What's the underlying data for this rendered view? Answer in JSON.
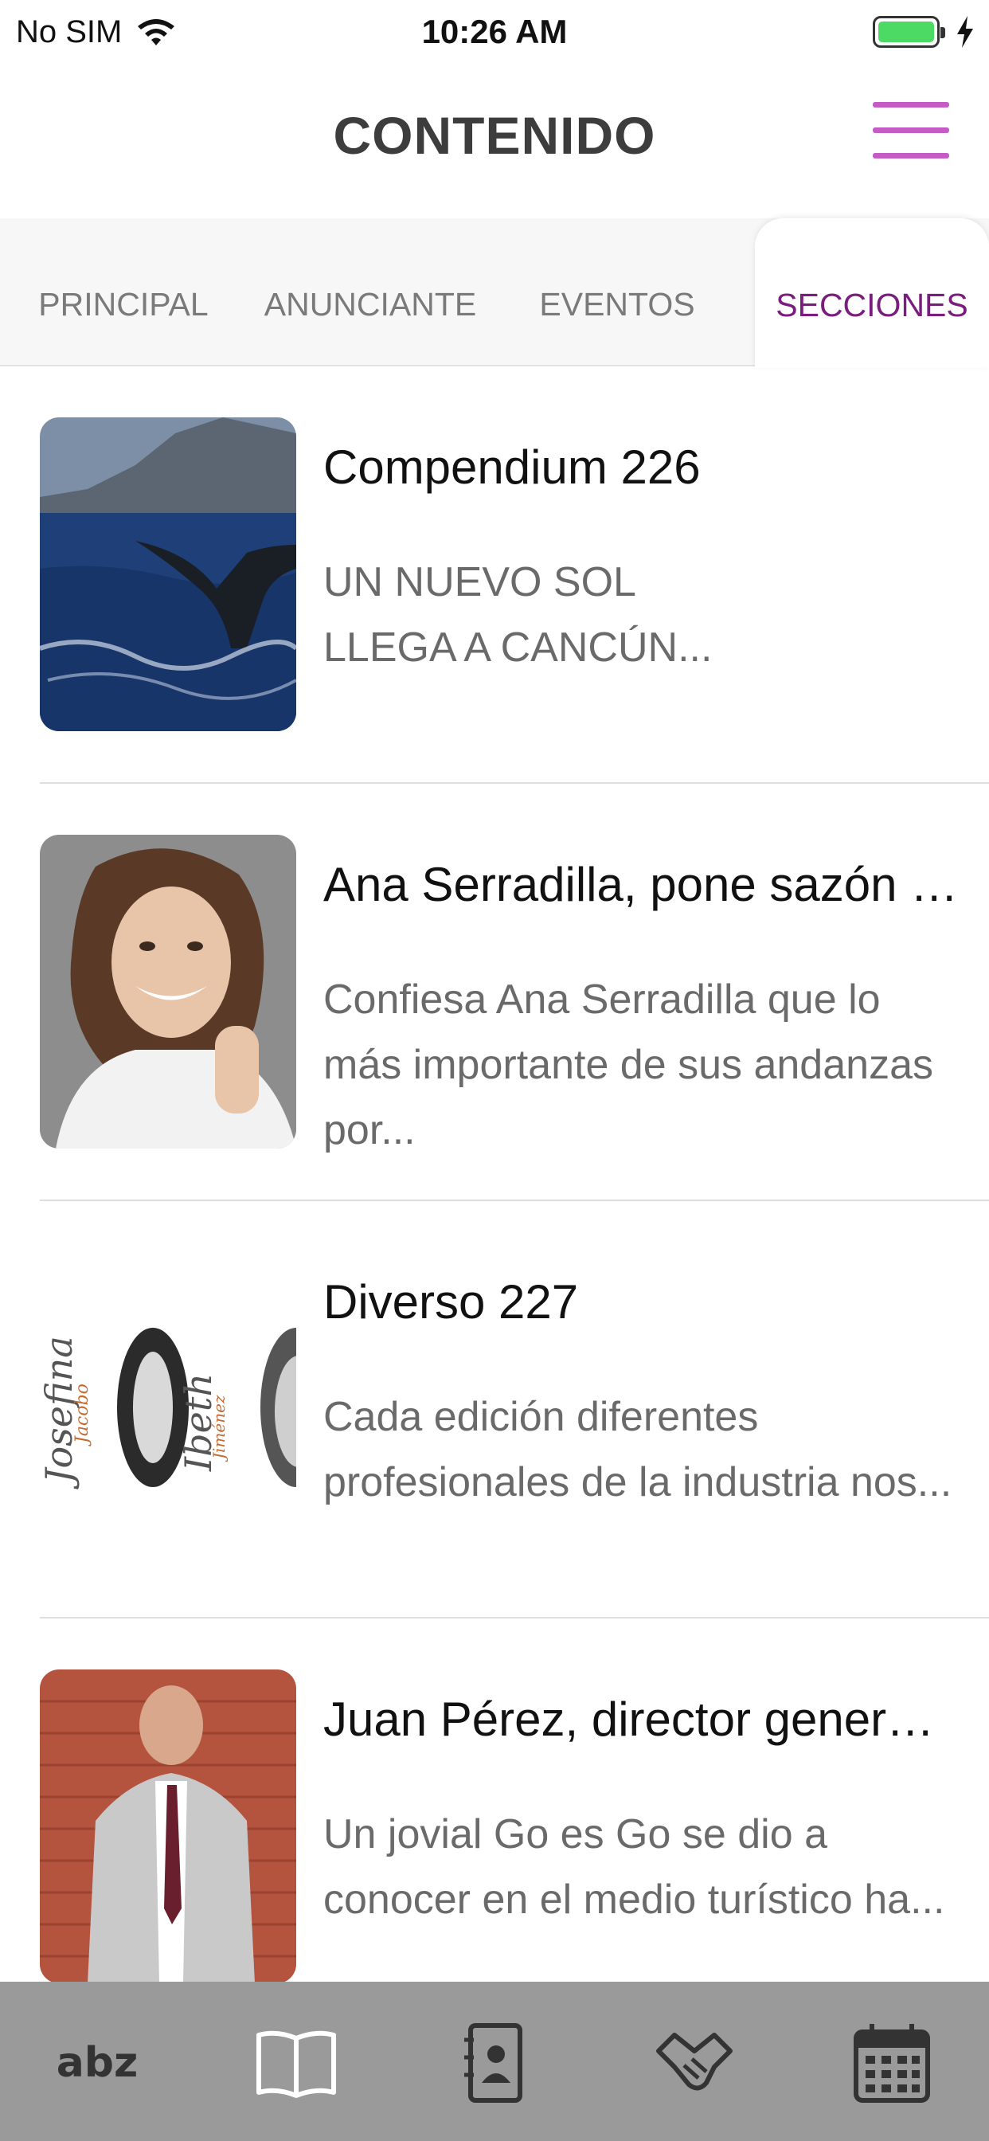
{
  "status_bar": {
    "carrier": "No SIM",
    "time": "10:26 AM",
    "battery_color": "#4cd964"
  },
  "header": {
    "title": "CONTENIDO",
    "menu_icon": "hamburger-menu-icon",
    "accent_color": "#c45cc4"
  },
  "tabs": [
    {
      "label": "PRINCIPAL",
      "active": false
    },
    {
      "label": "ANUNCIANTE",
      "active": false
    },
    {
      "label": "EVENTOS",
      "active": false
    },
    {
      "label": "SECCIONES",
      "active": true
    }
  ],
  "articles": [
    {
      "title": "Compendium 226",
      "description": "UN NUEVO SOL LLEGA A CANCÚN...",
      "image": "whale-tail-photo"
    },
    {
      "title": "Ana Serradilla, pone sazón a...",
      "description": "Confiesa Ana Serradilla que lo más importante de sus andanzas por...",
      "image": "woman-portrait-photo"
    },
    {
      "title": "Diverso 227",
      "description": "Cada edición diferentes profesionales de la industria nos...",
      "image": "portraits-collage-photo",
      "image_text": [
        "Josefina",
        "Jacobo",
        "Ibeth",
        "Jiménez"
      ]
    },
    {
      "title": "Juan Pérez, director general...",
      "description": "Un jovial Go es Go se dio a conocer en el medio turístico ha...",
      "image": "man-brick-wall-photo"
    }
  ],
  "bottom_nav": [
    {
      "icon": "abz-logo-icon",
      "text": "abz"
    },
    {
      "icon": "open-book-icon"
    },
    {
      "icon": "contact-book-icon"
    },
    {
      "icon": "handshake-icon"
    },
    {
      "icon": "calendar-icon"
    }
  ]
}
